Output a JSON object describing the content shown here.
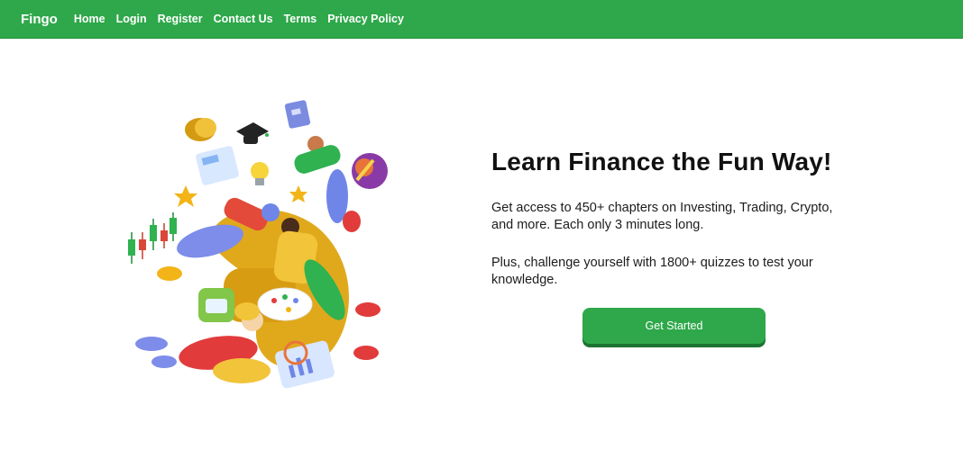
{
  "nav": {
    "brand": "Fingo",
    "links": [
      "Home",
      "Login",
      "Register",
      "Contact Us",
      "Terms",
      "Privacy Policy"
    ]
  },
  "hero": {
    "title": "Learn Finance the Fun Way!",
    "paragraph_1": "Get access to 450+ chapters on Investing, Trading, Crypto, and more. Each only 3 minutes long.",
    "paragraph_2": "Plus, challenge yourself with 1800+ quizzes to test your knowledge.",
    "cta_label": "Get Started"
  },
  "colors": {
    "brand_green": "#2ea84a",
    "button_shadow": "#1b7331",
    "text_dark": "#111111"
  }
}
